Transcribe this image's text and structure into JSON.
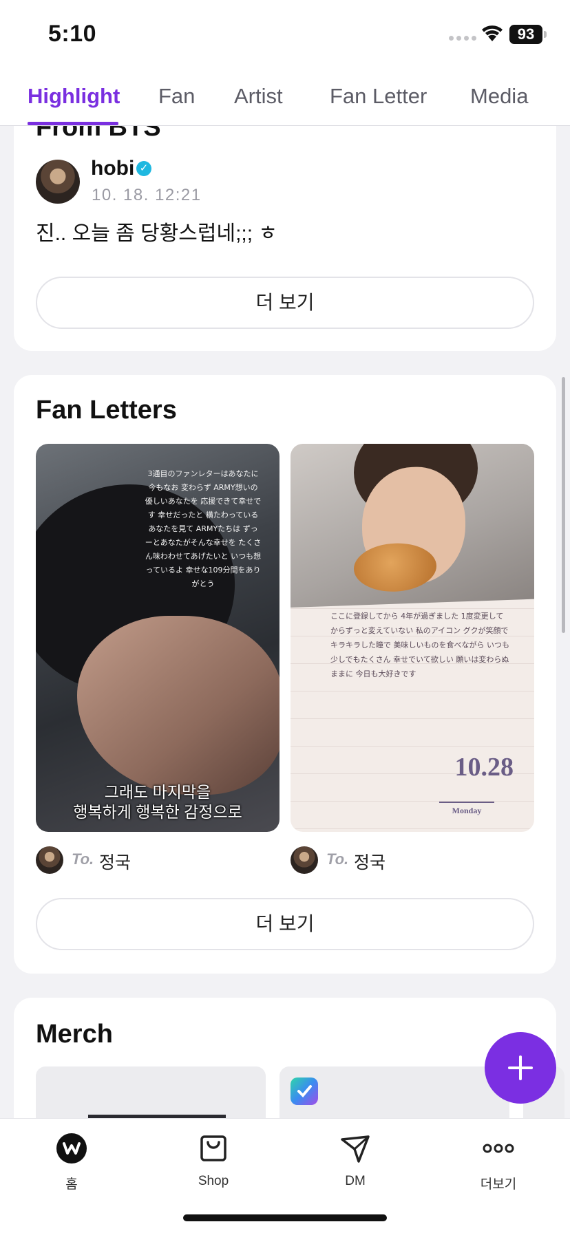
{
  "status_bar": {
    "time": "5:10",
    "battery": "93"
  },
  "tabs": [
    {
      "label": "Highlight",
      "active": true
    },
    {
      "label": "Fan",
      "active": false
    },
    {
      "label": "Artist",
      "active": false
    },
    {
      "label": "Fan Letter",
      "active": false
    },
    {
      "label": "Media",
      "active": false
    }
  ],
  "from_section": {
    "title": "From BTS",
    "author": "hobi",
    "date": "10. 18. 12:21",
    "text": "진.. 오늘 좀 당황스럽네;;; ㅎ",
    "more_label": "더 보기"
  },
  "fan_letters": {
    "title": "Fan Letters",
    "letter1_text": "3通目のファンレターはあなたに 今もなお 変わらず ARMY想いの優しいあなたを 応援できて幸せです 幸せだったと 横たわっているあなたを見て ARMYたちは ずっーとあなたがそんな幸せを たくさん味わわせてあげたいと いつも想っているよ 幸せな109分間をありがとう",
    "letter1_caption_line1": "그래도 마지막을",
    "letter1_caption_line2": "행복하게 행복한 감정으로",
    "letter2_text": "ここに登録してから 4年が過ぎました 1度変更してからずっと変えていない 私のアイコン グクが笑顔で キラキラした瞳で 美味しいものを食べながら いつも少しでもたくさん 幸せでいて欲しい 願いは変わらぬままに 今日も大好きです",
    "letter2_date": "10.28",
    "letter2_day": "Monday",
    "to_label": "To.",
    "recipients": [
      "정국",
      "정국"
    ],
    "more_label": "더 보기"
  },
  "merch": {
    "title": "Merch"
  },
  "bottom_nav": [
    {
      "label": "홈",
      "icon": "weverse-home-icon"
    },
    {
      "label": "Shop",
      "icon": "shopping-bag-icon"
    },
    {
      "label": "DM",
      "icon": "paper-plane-icon"
    },
    {
      "label": "더보기",
      "icon": "more-dots-icon"
    }
  ],
  "colors": {
    "accent": "#7a2fe0",
    "verified": "#1fb8e0"
  }
}
